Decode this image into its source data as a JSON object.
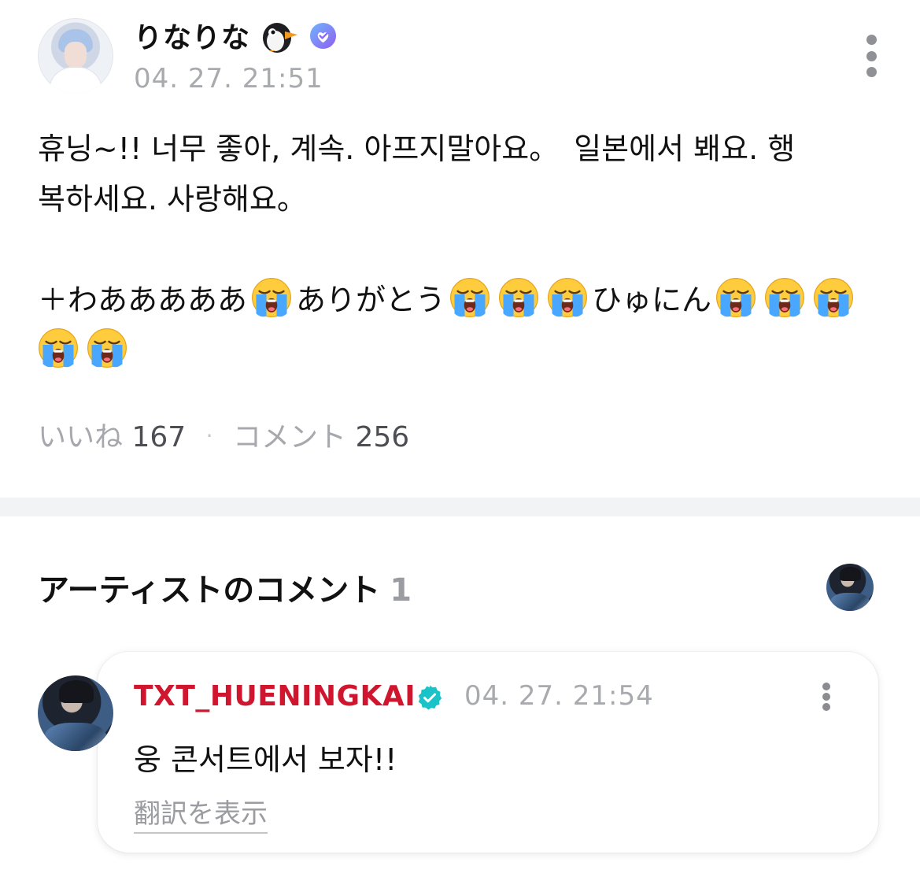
{
  "post": {
    "author": "りなりな",
    "author_badge_icon": "penguin-icon",
    "verified_icon": "verified-purple-icon",
    "timestamp": "04. 27. 21:51",
    "body_line1": "휴닝~!! 너무 좋아, 계속. 아프지말아요。　일본에서 봬요. 행",
    "body_line2": "복하세요. 사랑해요。",
    "body_line3_a": "＋わあああああ",
    "body_line3_b": "ありがとう",
    "body_line3_c": "ひゅにん",
    "emoji_name": "loudly-crying-face",
    "stats": {
      "likes_label": "いいね",
      "likes_count": "167",
      "separator": "·",
      "comments_label": "コメント",
      "comments_count": "256"
    }
  },
  "artist_comments": {
    "title": "アーティストのコメント",
    "count": "1",
    "comment": {
      "author": "TXT_HUENINGKAI",
      "verified_icon": "verified-teal-icon",
      "timestamp": "04. 27. 21:54",
      "text": "웅 콘서트에서 보자!!",
      "translate_label": "翻訳を表示"
    }
  },
  "colors": {
    "artist_name": "#d0162e",
    "verified_teal": "#19c3c7",
    "verified_purple": "#7f6df2",
    "muted_text": "#a8aaae",
    "divider": "#f2f3f5"
  }
}
